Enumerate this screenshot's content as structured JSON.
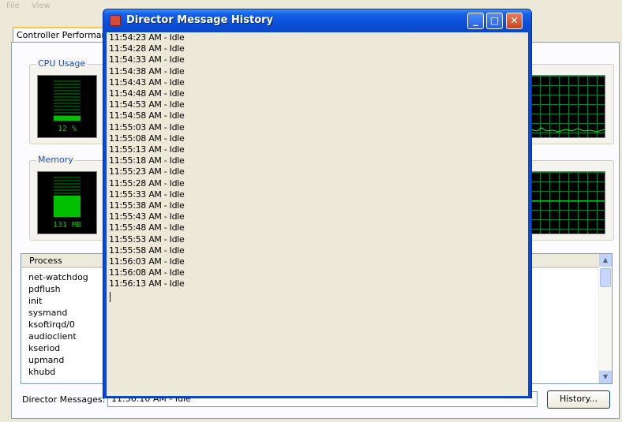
{
  "menubar": {
    "items": [
      "File",
      "View"
    ]
  },
  "main_tab": {
    "label": "Controller Performance"
  },
  "cpu": {
    "title": "CPU Usage",
    "value_text": "12 %",
    "level": 0.12
  },
  "memory": {
    "title": "Memory",
    "value_text": "131 MB",
    "level": 0.55
  },
  "process_list": {
    "column_header": "Process",
    "items": [
      "net-watchdog",
      "pdflush",
      "init",
      "sysmand",
      "ksoftirqd/0",
      "audioclient",
      "kseriod",
      "upmand",
      "khubd"
    ]
  },
  "director_messages": {
    "label": "Director Messages:",
    "value": "11:56:10 AM - Idle"
  },
  "history_button": {
    "label": "History..."
  },
  "dialog": {
    "title": "Director Message History",
    "messages": [
      "11:54:23 AM - Idle",
      "11:54:28 AM - Idle",
      "11:54:33 AM - Idle",
      "11:54:38 AM - Idle",
      "11:54:43 AM - Idle",
      "11:54:48 AM - Idle",
      "11:54:53 AM - Idle",
      "11:54:58 AM - Idle",
      "11:55:03 AM - Idle",
      "11:55:08 AM - Idle",
      "11:55:13 AM - Idle",
      "11:55:18 AM - Idle",
      "11:55:23 AM - Idle",
      "11:55:28 AM - Idle",
      "11:55:33 AM - Idle",
      "11:55:38 AM - Idle",
      "11:55:43 AM - Idle",
      "11:55:48 AM - Idle",
      "11:55:53 AM - Idle",
      "11:55:58 AM - Idle",
      "11:56:03 AM - Idle",
      "11:56:08 AM - Idle",
      "11:56:13 AM - Idle"
    ]
  },
  "colors": {
    "title_bar": "#0a4fd8",
    "meter_green": "#00c000",
    "group_title": "#1f4ec2"
  }
}
